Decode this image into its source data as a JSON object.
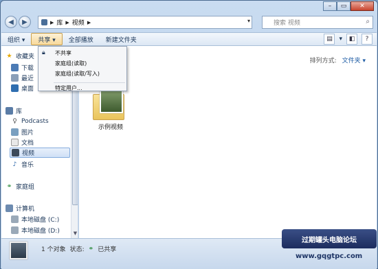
{
  "window": {
    "min": "–",
    "max": "▭",
    "close": "✕"
  },
  "address": {
    "segments": [
      "库",
      "视频"
    ]
  },
  "search": {
    "placeholder": "搜索 视频"
  },
  "toolbar": {
    "organize": "组织 ▾",
    "share": "共享 ▾",
    "playall": "全部播放",
    "newfolder": "新建文件夹"
  },
  "share_menu": {
    "items": [
      "不共享",
      "家庭组(读取)",
      "家庭组(读取/写入)",
      "特定用户..."
    ]
  },
  "sidebar": {
    "favorites": "收藏夹",
    "fav_items": [
      "下载",
      "最近",
      "桌面"
    ],
    "libraries": "库",
    "lib_items": [
      "Podcasts",
      "图片",
      "文档",
      "视频",
      "音乐"
    ],
    "homegroup": "家庭组",
    "computer": "计算机",
    "drives": [
      "本地磁盘 (C:)",
      "本地磁盘 (D:)"
    ]
  },
  "content": {
    "arrange_label": "排列方式:",
    "arrange_value": "文件夹 ▾",
    "folder_name": "示例视频"
  },
  "status": {
    "count": "1 个对象",
    "state_label": "状态:",
    "state_value": "已共享"
  },
  "watermark": {
    "text": "过期罐头电脑论坛",
    "url": "www.gqgtpc.com"
  }
}
